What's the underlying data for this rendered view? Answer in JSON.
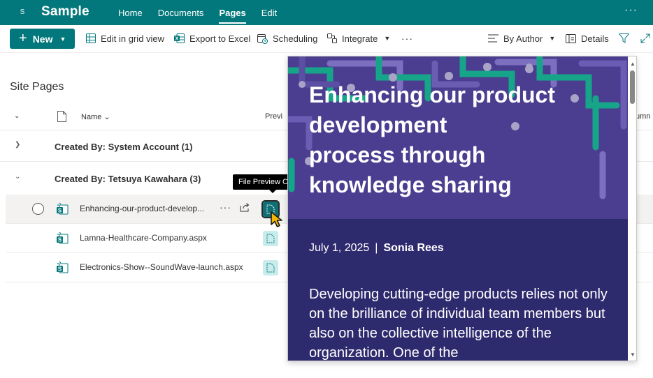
{
  "site": {
    "icon_letter": "S",
    "name": "Sample"
  },
  "nav": {
    "items": [
      "Home",
      "Documents",
      "Pages",
      "Edit"
    ],
    "active": "Pages",
    "more": "···"
  },
  "toolbar": {
    "new_label": "New",
    "edit_grid": "Edit in grid view",
    "export_excel": "Export to Excel",
    "scheduling": "Scheduling",
    "integrate": "Integrate",
    "more": "···",
    "by_author": "By Author",
    "details": "Details"
  },
  "list": {
    "heading": "Site Pages",
    "columns": {
      "name": "Name",
      "preview": "Previ",
      "extra": "umn"
    },
    "groups": [
      {
        "label": "Created By: System Account (1)",
        "expanded": false
      },
      {
        "label": "Created By: Tetsuya Kawahara (3)",
        "expanded": true
      }
    ],
    "files": [
      {
        "name": "Enhancing-our-product-develop...",
        "selected": true
      },
      {
        "name": "Lamna-Healthcare-Company.aspx",
        "selected": false
      },
      {
        "name": "Electronics-Show--SoundWave-launch.aspx",
        "selected": false
      }
    ]
  },
  "tooltip": "File Preview Callout",
  "preview": {
    "title": " Enhancing our product\ndevelopment\n process through\nknowledge sharing",
    "date": "July 1, 2025",
    "separator": "|",
    "author": "Sonia Rees",
    "excerpt": "Developing cutting-edge products relies not only on the brilliance of individual team members but also on the collective intelligence of the organization. One of the",
    "colors": {
      "hero": "#4b3d8f",
      "body": "#2e2a6e",
      "accent": "#17a589"
    }
  },
  "colors": {
    "brand": "#03787c"
  }
}
